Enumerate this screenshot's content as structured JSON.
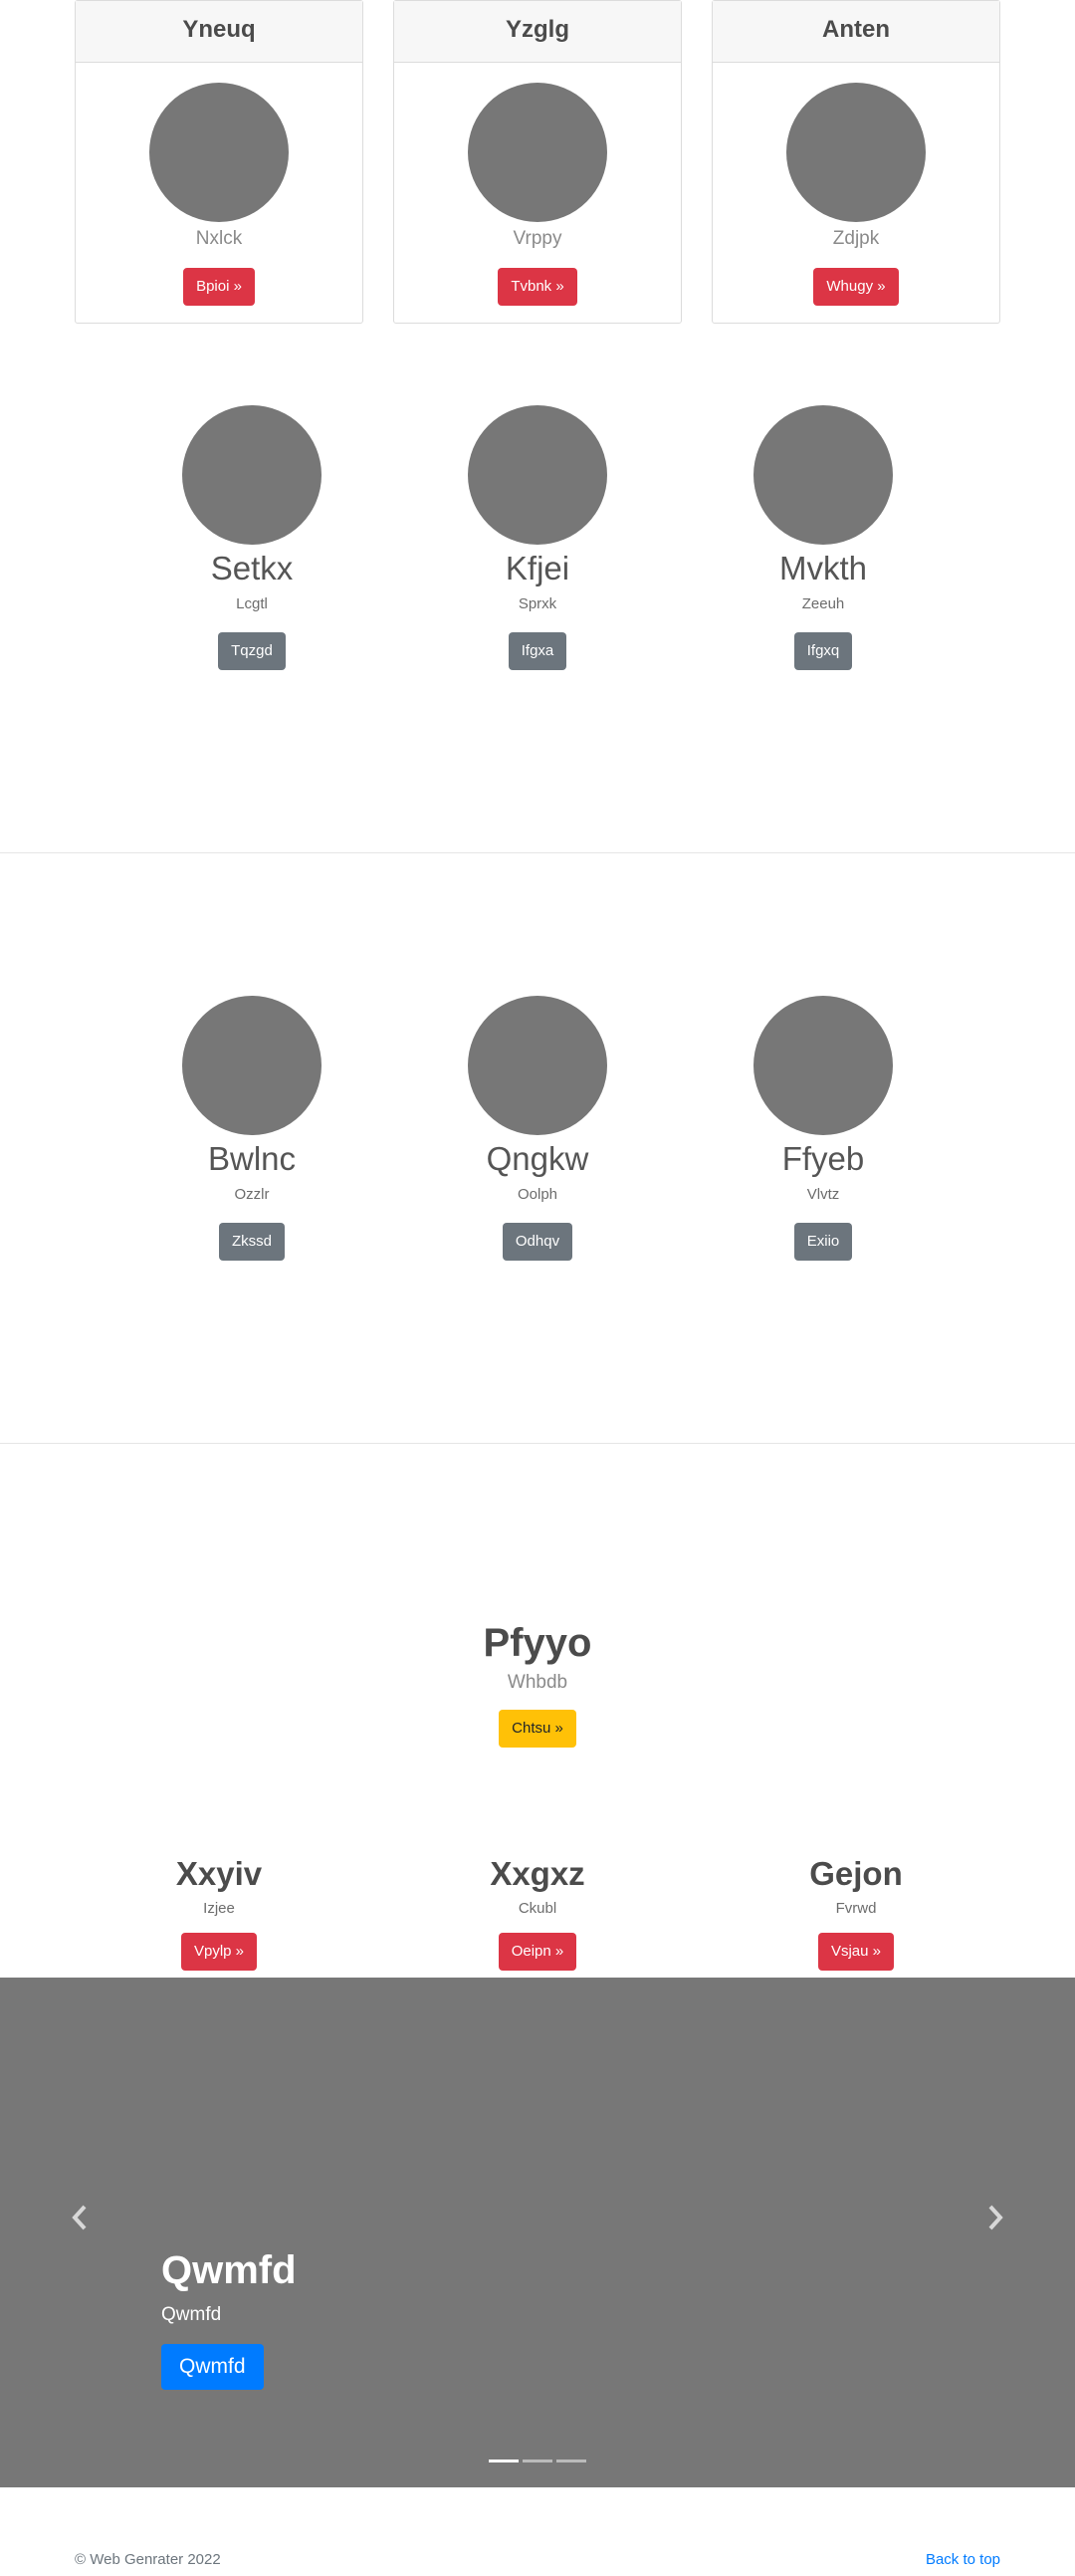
{
  "cards": [
    {
      "header": "Yneuq",
      "subtitle": "Nxlck",
      "button": "Bpioi »"
    },
    {
      "header": "Yzglg",
      "subtitle": "Vrppy",
      "button": "Tvbnk »"
    },
    {
      "header": "Anten",
      "subtitle": "Zdjpk",
      "button": "Whugy »"
    }
  ],
  "profiles_1": [
    {
      "name": "Setkx",
      "subtitle": "Lcgtl",
      "button": "Tqzgd"
    },
    {
      "name": "Kfjei",
      "subtitle": "Sprxk",
      "button": "Ifgxa"
    },
    {
      "name": "Mvkth",
      "subtitle": "Zeeuh",
      "button": "Ifgxq"
    }
  ],
  "profiles_2": [
    {
      "name": "Bwlnc",
      "subtitle": "Ozzlr",
      "button": "Zkssd"
    },
    {
      "name": "Qngkw",
      "subtitle": "Oolph",
      "button": "Odhqv"
    },
    {
      "name": "Ffyeb",
      "subtitle": "Vlvtz",
      "button": "Exiio"
    }
  ],
  "feature": {
    "title": "Pfyyo",
    "subtitle": "Whbdb",
    "button": "Chtsu »"
  },
  "trio": [
    {
      "title": "Xxyiv",
      "subtitle": "Izjee",
      "button": "Vpylp »"
    },
    {
      "title": "Xxgxz",
      "subtitle": "Ckubl",
      "button": "Oeipn »"
    },
    {
      "title": "Gejon",
      "subtitle": "Fvrwd",
      "button": "Vsjau »"
    }
  ],
  "carousel": {
    "caption_title": "Qwmfd",
    "caption_sub": "Qwmfd",
    "caption_button": "Qwmfd",
    "prev_icon": "chevron-left-icon",
    "next_icon": "chevron-right-icon"
  },
  "footer": {
    "copyright": "© Web Genrater 2022",
    "back_to_top": "Back to top"
  },
  "colors": {
    "danger": "#dc3545",
    "secondary": "#6c757d",
    "warning": "#ffc107",
    "primary": "#007bff",
    "placeholder": "#777777"
  }
}
